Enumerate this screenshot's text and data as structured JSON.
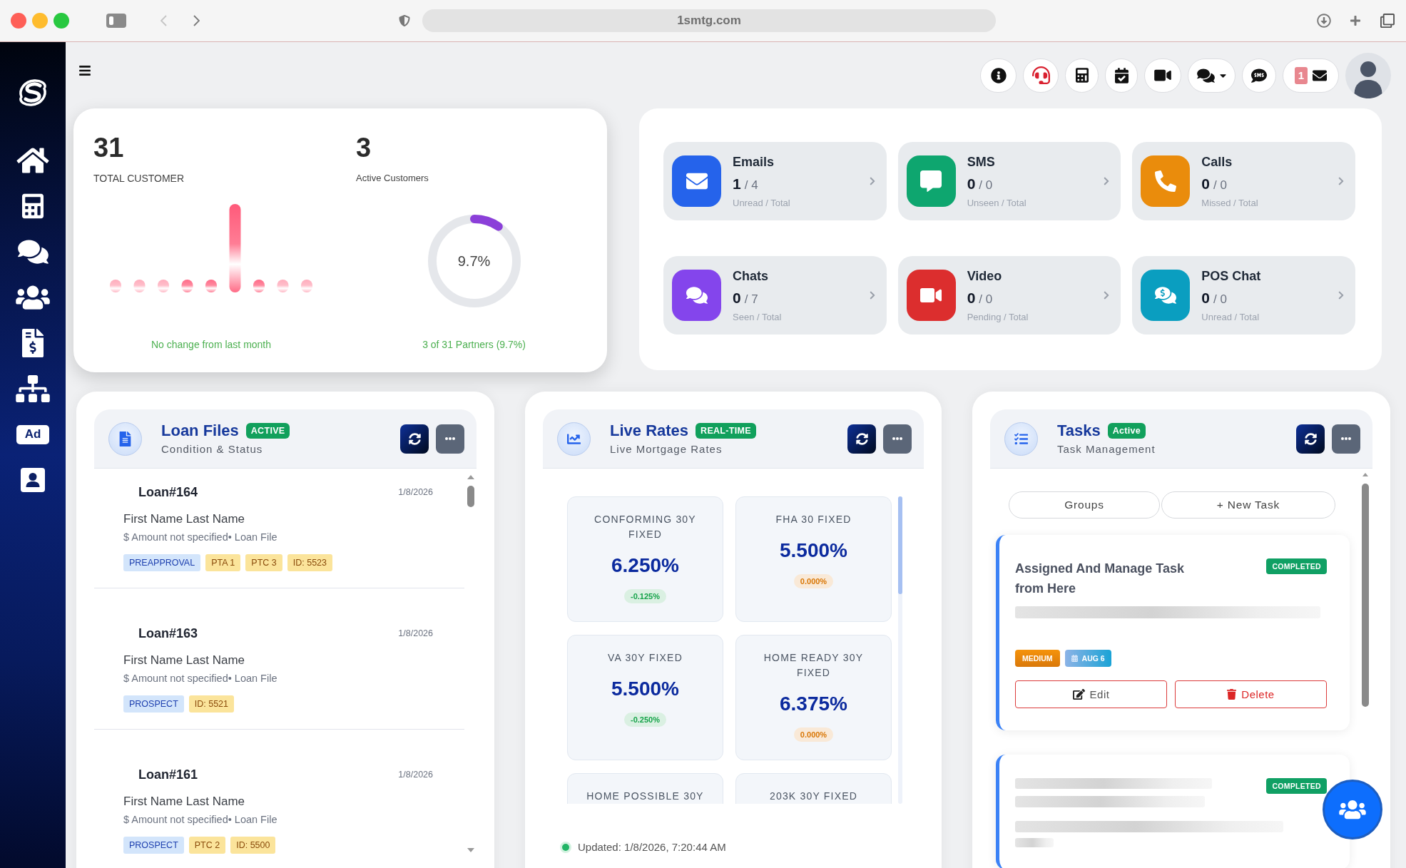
{
  "browser": {
    "url": "1smtg.com"
  },
  "sidebar": {
    "ad_label": "Ad"
  },
  "toolbar": {
    "mail_count": "1"
  },
  "customers": {
    "total": "31",
    "total_label": "TOTAL CUSTOMER",
    "total_note": "No change from last month",
    "active": "3",
    "active_label": "Active Customers",
    "active_percent": "9.7%",
    "level": 0.097,
    "active_note": "3 of 31 Partners (9.7%)"
  },
  "messages": [
    {
      "title": "Emails",
      "count": "1",
      "total": "/ 4",
      "caption": "Unread / Total",
      "color": "#2563eb"
    },
    {
      "title": "SMS",
      "count": "0",
      "total": "/ 0",
      "caption": "Unseen / Total",
      "color": "#0ea66f"
    },
    {
      "title": "Calls",
      "count": "0",
      "total": "/ 0",
      "caption": "Missed / Total",
      "color": "#ea8c0c"
    },
    {
      "title": "Chats",
      "count": "0",
      "total": "/ 7",
      "caption": "Seen / Total",
      "color": "#8445ec"
    },
    {
      "title": "Video",
      "count": "0",
      "total": "/ 0",
      "caption": "Pending / Total",
      "color": "#dc2e2e"
    },
    {
      "title": "POS Chat",
      "count": "0",
      "total": "/ 0",
      "caption": "Unread / Total",
      "color": "#0a9ec0"
    }
  ],
  "loan_files": {
    "title": "Loan Files",
    "badge": "ACTIVE",
    "subtitle": "Condition & Status",
    "items": [
      {
        "loan": "Loan#164",
        "date": "1/8/2026",
        "name": "First Name Last Name",
        "detail": "$ Amount not specified• Loan File",
        "tags": [
          {
            "text": "PREAPPROVAL",
            "kind": "status"
          },
          {
            "text": "PTA 1",
            "kind": "info"
          },
          {
            "text": "PTC 3",
            "kind": "info"
          },
          {
            "text": "ID: 5523",
            "kind": "info"
          }
        ]
      },
      {
        "loan": "Loan#163",
        "date": "1/8/2026",
        "name": "First Name Last Name",
        "detail": "$ Amount not specified• Loan File",
        "tags": [
          {
            "text": "PROSPECT",
            "kind": "status"
          },
          {
            "text": "ID: 5521",
            "kind": "info"
          }
        ]
      },
      {
        "loan": "Loan#161",
        "date": "1/8/2026",
        "name": "First Name Last Name",
        "detail": "$ Amount not specified• Loan File",
        "tags": [
          {
            "text": "PROSPECT",
            "kind": "status"
          },
          {
            "text": "PTC 2",
            "kind": "info"
          },
          {
            "text": "ID: 5500",
            "kind": "info"
          }
        ]
      }
    ]
  },
  "live_rates": {
    "title": "Live Rates",
    "badge": "REAL-TIME",
    "subtitle": "Live Mortgage Rates",
    "rates": [
      {
        "name": "CONFORMING 30Y FIXED",
        "rate": "6.250%",
        "change": "-0.125%",
        "color": "#16a34a"
      },
      {
        "name": "FHA 30 FIXED",
        "rate": "5.500%",
        "change": "0.000%",
        "color": "#d97706"
      },
      {
        "name": "VA 30Y FIXED",
        "rate": "5.500%",
        "change": "-0.250%",
        "color": "#16a34a"
      },
      {
        "name": "HOME READY 30Y FIXED",
        "rate": "6.375%",
        "change": "0.000%",
        "color": "#d97706"
      },
      {
        "name": "HOME POSSIBLE 30Y"
      },
      {
        "name": "203K 30Y FIXED"
      }
    ],
    "updated": "Updated: 1/8/2026, 7:20:44 AM"
  },
  "tasks": {
    "title": "Tasks",
    "badge": "Active",
    "subtitle": "Task Management",
    "actions": [
      "Groups",
      "+ New Task"
    ],
    "items": [
      {
        "title": "Assigned And Manage Task from Here",
        "status": "COMPLETED",
        "priority": "MEDIUM",
        "due": "AUG 6",
        "buttons": [
          {
            "label": "Edit",
            "kind": "edit"
          },
          {
            "label": "Delete",
            "kind": "delete"
          }
        ]
      },
      {
        "status": "COMPLETED"
      }
    ]
  }
}
